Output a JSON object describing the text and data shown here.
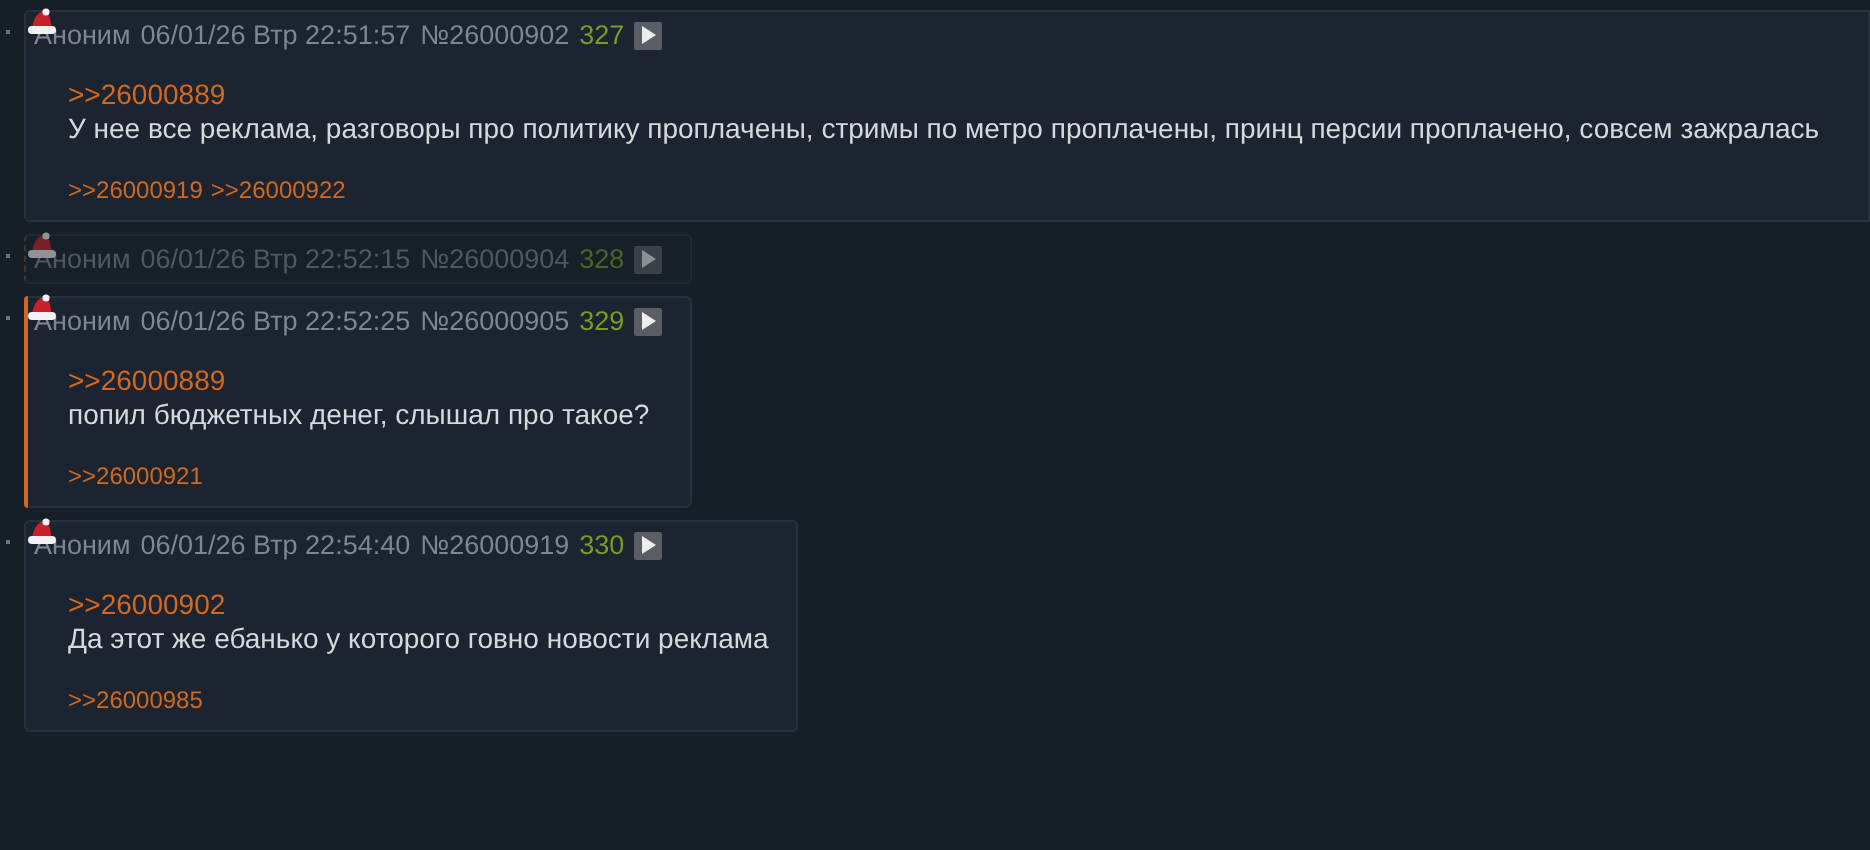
{
  "posts": [
    {
      "name": "Аноним",
      "date": "06/01/26 Втр 22:51:57",
      "number": "№26000902",
      "index": "327",
      "hidden": false,
      "highlighted": false,
      "wide": true,
      "quote": ">>26000889",
      "text": "У нее все реклама, разговоры про политику проплачены, стримы по метро проплачены, принц персии проплачено, совсем зажралась",
      "replies": [
        ">>26000919",
        ">>26000922"
      ]
    },
    {
      "name": "Аноним",
      "date": "06/01/26 Втр 22:52:15",
      "number": "№26000904",
      "index": "328",
      "hidden": true,
      "highlighted": false,
      "wide": false
    },
    {
      "name": "Аноним",
      "date": "06/01/26 Втр 22:52:25",
      "number": "№26000905",
      "index": "329",
      "hidden": false,
      "highlighted": true,
      "wide": false,
      "quote": ">>26000889",
      "text": "попил бюджетных денег, слышал про такое?",
      "replies": [
        ">>26000921"
      ]
    },
    {
      "name": "Аноним",
      "date": "06/01/26 Втр 22:54:40",
      "number": "№26000919",
      "index": "330",
      "hidden": false,
      "highlighted": false,
      "wide": false,
      "quote": ">>26000902",
      "text": "Да этот же ебанько у которого говно новости реклама",
      "replies": [
        ">>26000985"
      ]
    }
  ]
}
